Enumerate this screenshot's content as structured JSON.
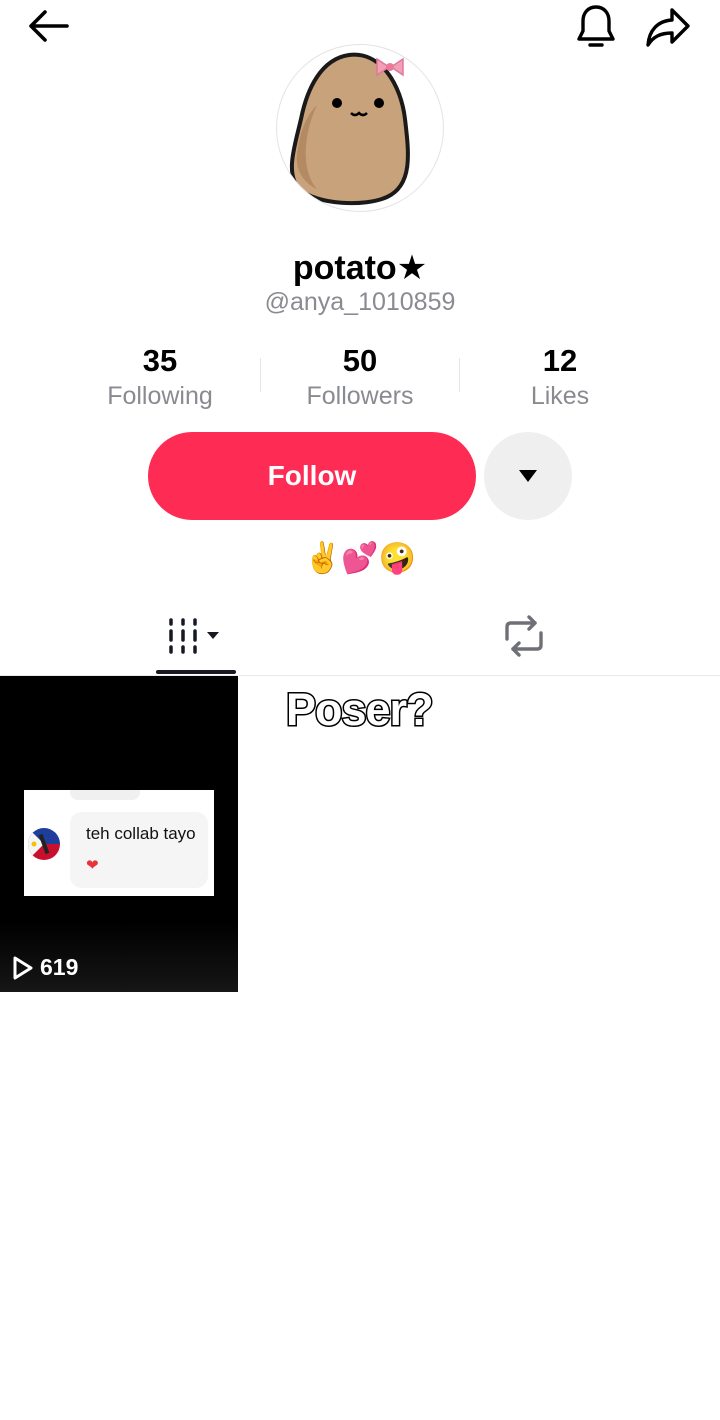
{
  "header": {
    "back_icon": "arrow-left-icon",
    "notification_icon": "bell-icon",
    "share_icon": "share-arrow-icon"
  },
  "profile": {
    "avatar_icon": "potato-with-bow-avatar",
    "display_name": "potato★",
    "username": "@anya_1010859",
    "bio": "✌️💕🤪"
  },
  "stats": [
    {
      "value": "35",
      "label": "Following"
    },
    {
      "value": "50",
      "label": "Followers"
    },
    {
      "value": "12",
      "label": "Likes"
    }
  ],
  "actions": {
    "follow_label": "Follow",
    "more_icon": "caret-down-icon",
    "follow_color": "#fe2c55"
  },
  "tabs": {
    "videos_icon": "video-grid-icon",
    "reposts_icon": "repost-icon",
    "active": "videos"
  },
  "videos": [
    {
      "chat_text": "teh collab tayo",
      "chat_heart": "❤",
      "play_count": "619"
    }
  ],
  "overlay_caption": "Poser?"
}
